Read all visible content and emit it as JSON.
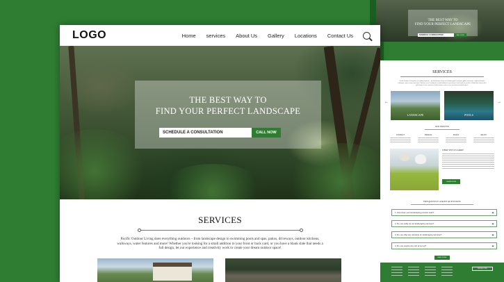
{
  "header": {
    "logo": "LOGO",
    "nav": [
      "Home",
      "services",
      "About Us",
      "Gallery",
      "Locations",
      "Contact Us"
    ]
  },
  "hero": {
    "title_line1": "THE BEST WAY TO",
    "title_line2": "FIND YOUR PERFECT LANDSCAPE",
    "cta_label": "SCHEDULE A CONSULTATION",
    "cta_button": "CALL NOW"
  },
  "services": {
    "title": "SERVICES",
    "description": "Pacific Outdoor Living does everything outdoors – from landscape design to swimming pools and spas, patios, driveways, outdoor kitchens, walkways, water features and more! Whether you're looking for a small addition to your front or back yard, or you have a blank slate that needs a full design, let our experience and creativity work to create your dream outdoor space!"
  },
  "mobile": {
    "services_title": "SERVICES",
    "cards": [
      "LANDSCAPE",
      "POOLS"
    ],
    "our_process": "OUR PROCESS",
    "steps": [
      "CONSULT",
      "DESIGN",
      "BUILD",
      "ENJOY"
    ],
    "why_title": "WHAT SETS US APART",
    "why_button": "LEARN MORE",
    "faq_title": "FREQUENTLY ASKED QUESTIONS",
    "faqs": [
      "1. How does your landscaping process work?",
      "2. Do you really do not landscaping services?",
      "3. Do you offer any warranty on landscaping services?",
      "4. Do you require any sort of set up?"
    ],
    "faq_button": "READ MORE",
    "newsletter": "NEWSLETTER"
  },
  "colors": {
    "background": "#2e7d32",
    "accent": "#2e7d32"
  }
}
